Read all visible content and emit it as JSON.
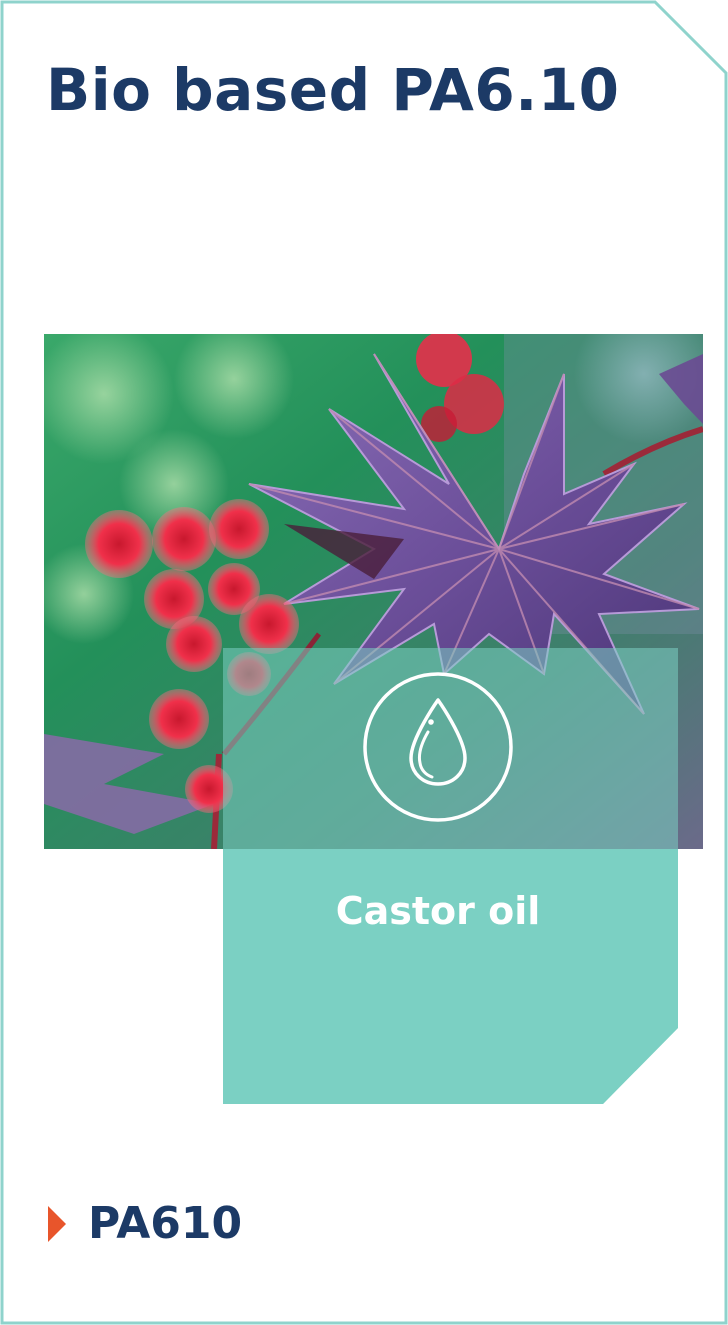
{
  "title": "Bio based PA6.10",
  "feedstock": {
    "label": "Castor oil",
    "icon": "oil-drop-icon"
  },
  "product": {
    "label": "PA610",
    "icon": "arrow-right-icon"
  },
  "colors": {
    "title": "#1c3a66",
    "frame": "#8fd3cc",
    "overlay": "#7bd0c3",
    "arrow": "#e8552b"
  }
}
